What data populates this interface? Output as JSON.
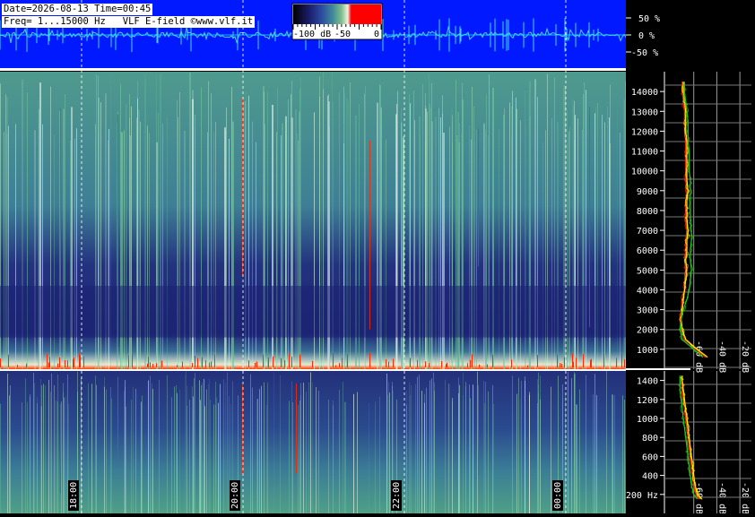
{
  "header": {
    "line1": "Date=2026-08-13 Time=00:45",
    "line2": "Freq= 1...15000 Hz   VLF E-field ©www.vlf.it"
  },
  "colorbar": {
    "labels": [
      "-100 dB",
      "-50",
      "0"
    ]
  },
  "waveform": {
    "percent_labels": [
      "50 %",
      "0 %",
      "-50 %"
    ]
  },
  "colors": {
    "waveform_bg": "#0019ff",
    "trace": "#3fd8ff",
    "spectrum_red": "#ff2a00",
    "spectrum_yellow": "#fff200",
    "spectrum_green": "#27c41e"
  },
  "chart_data": [
    {
      "type": "heatmap",
      "name": "upper-spectrogram",
      "ylabel": "",
      "ylim": [
        0,
        15000
      ],
      "y_ticks": [
        "1000",
        "2000",
        "3000",
        "4000",
        "5000",
        "6000",
        "7000",
        "8000",
        "9000",
        "10000",
        "11000",
        "12000",
        "13000",
        "14000"
      ],
      "y_tick_values": [
        1000,
        2000,
        3000,
        4000,
        5000,
        6000,
        7000,
        8000,
        9000,
        10000,
        11000,
        12000,
        13000,
        14000
      ],
      "time_ticks": [
        "18:00",
        "20:00",
        "22:00",
        "00:00"
      ],
      "colormap": [
        "#000000",
        "#1a1d6b",
        "#2c4aa0",
        "#3f8a9a",
        "#7fc08a",
        "#f0f0e0",
        "#ff0000"
      ]
    },
    {
      "type": "heatmap",
      "name": "lower-spectrogram",
      "ylabel": "",
      "ylim": [
        0,
        1500
      ],
      "y_ticks": [
        "200 Hz",
        "400",
        "600",
        "800",
        "1000",
        "1200",
        "1400"
      ],
      "y_tick_values": [
        200,
        400,
        600,
        800,
        1000,
        1200,
        1400
      ],
      "time_ticks": [
        "18:00",
        "20:00",
        "22:00",
        "00:00"
      ]
    },
    {
      "type": "line",
      "name": "upper-spectrum",
      "x_ticks": [
        "-60 dB",
        "-40 dB",
        "-20 dB"
      ],
      "x_tick_values": [
        -60,
        -40,
        -20
      ],
      "xlim": [
        -80,
        -10
      ],
      "series": [
        {
          "color": "#ff2a00",
          "y": [
            600,
            1000,
            1500,
            2000,
            2500,
            3000,
            3500,
            4000,
            4500,
            5000,
            5500,
            6000,
            6500,
            7000,
            7500,
            8000,
            8500,
            9000,
            9500,
            10000,
            10500,
            11000,
            11500,
            12000,
            12500,
            13000,
            13500,
            14000,
            14500
          ],
          "x": [
            -50,
            -58,
            -68,
            -71,
            -72,
            -71,
            -70,
            -68,
            -68,
            -67,
            -68,
            -67,
            -67,
            -66,
            -67,
            -67,
            -67,
            -66,
            -67,
            -67,
            -67,
            -67,
            -67,
            -68,
            -68,
            -68,
            -69,
            -70,
            -70
          ]
        },
        {
          "color": "#fff200",
          "y": [
            600,
            1000,
            1500,
            2000,
            2500,
            3000,
            3500,
            4000,
            4500,
            5000,
            5500,
            6000,
            6500,
            7000,
            7500,
            8000,
            8500,
            9000,
            9500,
            10000,
            10500,
            11000,
            11500,
            12000,
            12500,
            13000,
            13500,
            14000,
            14500
          ],
          "x": [
            -48,
            -57,
            -67,
            -70,
            -71,
            -70,
            -69,
            -68,
            -67,
            -66,
            -67,
            -66,
            -66,
            -65,
            -66,
            -66,
            -66,
            -65,
            -66,
            -66,
            -66,
            -66,
            -66,
            -67,
            -67,
            -67,
            -68,
            -69,
            -69
          ]
        },
        {
          "color": "#27c41e",
          "y": [
            600,
            1000,
            1500,
            2000,
            2500,
            3000,
            3500,
            4000,
            4500,
            5000,
            5500,
            6000,
            6500,
            7000,
            7500,
            8000,
            8500,
            9000,
            9500,
            10000,
            10500,
            11000,
            11500,
            12000,
            12500,
            13000,
            13500,
            14000,
            14500
          ],
          "x": [
            -52,
            -60,
            -70,
            -72,
            -71,
            -69,
            -66,
            -64,
            -63,
            -62,
            -63,
            -63,
            -62,
            -62,
            -63,
            -63,
            -63,
            -63,
            -63,
            -64,
            -64,
            -64,
            -65,
            -65,
            -65,
            -66,
            -67,
            -68,
            -68
          ]
        }
      ]
    },
    {
      "type": "line",
      "name": "lower-spectrum",
      "x_ticks": [
        "-60 dB",
        "-40 dB",
        "-20 dB"
      ],
      "x_tick_values": [
        -60,
        -40,
        -20
      ],
      "xlim": [
        -80,
        -10
      ],
      "series": [
        {
          "color": "#ff2a00",
          "y": [
            150,
            200,
            300,
            400,
            500,
            600,
            700,
            800,
            900,
            1000,
            1100,
            1200,
            1300,
            1400,
            1450
          ],
          "x": [
            -55,
            -58,
            -60,
            -61,
            -62,
            -63,
            -64,
            -65,
            -66,
            -67,
            -68,
            -69,
            -70,
            -71,
            -71
          ]
        },
        {
          "color": "#fff200",
          "y": [
            150,
            200,
            300,
            400,
            500,
            600,
            700,
            800,
            900,
            1000,
            1100,
            1200,
            1300,
            1400,
            1450
          ],
          "x": [
            -53,
            -57,
            -59,
            -60,
            -61,
            -62,
            -63,
            -64,
            -65,
            -66,
            -67,
            -68,
            -69,
            -70,
            -70
          ]
        },
        {
          "color": "#27c41e",
          "y": [
            150,
            200,
            300,
            400,
            500,
            600,
            700,
            800,
            900,
            1000,
            1100,
            1200,
            1300,
            1400,
            1450
          ],
          "x": [
            -57,
            -60,
            -62,
            -63,
            -64,
            -65,
            -66,
            -67,
            -68,
            -69,
            -70,
            -71,
            -72,
            -72,
            -72
          ]
        }
      ]
    }
  ]
}
